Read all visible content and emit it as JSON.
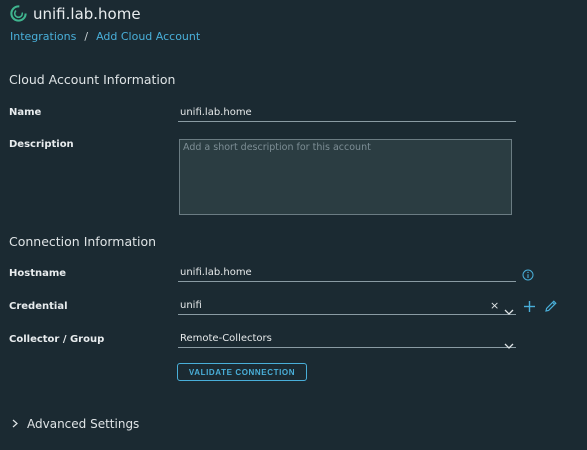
{
  "header": {
    "title": "unifi.lab.home",
    "logo_icon": "vrealize-logo-icon"
  },
  "breadcrumb": {
    "items": [
      "Integrations",
      "Add Cloud Account"
    ],
    "separator": "/"
  },
  "cloud_account": {
    "section_title": "Cloud Account Information",
    "name_label": "Name",
    "name_value": "unifi.lab.home",
    "description_label": "Description",
    "description_placeholder": "Add a short description for this account",
    "description_value": ""
  },
  "connection": {
    "section_title": "Connection Information",
    "hostname_label": "Hostname",
    "hostname_value": "unifi.lab.home",
    "credential_label": "Credential",
    "credential_value": "unifi",
    "clear_glyph": "×",
    "collector_label": "Collector / Group",
    "collector_value": "Remote-Collectors",
    "validate_label": "VALIDATE CONNECTION"
  },
  "advanced": {
    "label": "Advanced Settings"
  },
  "colors": {
    "background": "#1b2a32",
    "accent": "#49afd9",
    "textarea_bg": "#2b3d42"
  }
}
